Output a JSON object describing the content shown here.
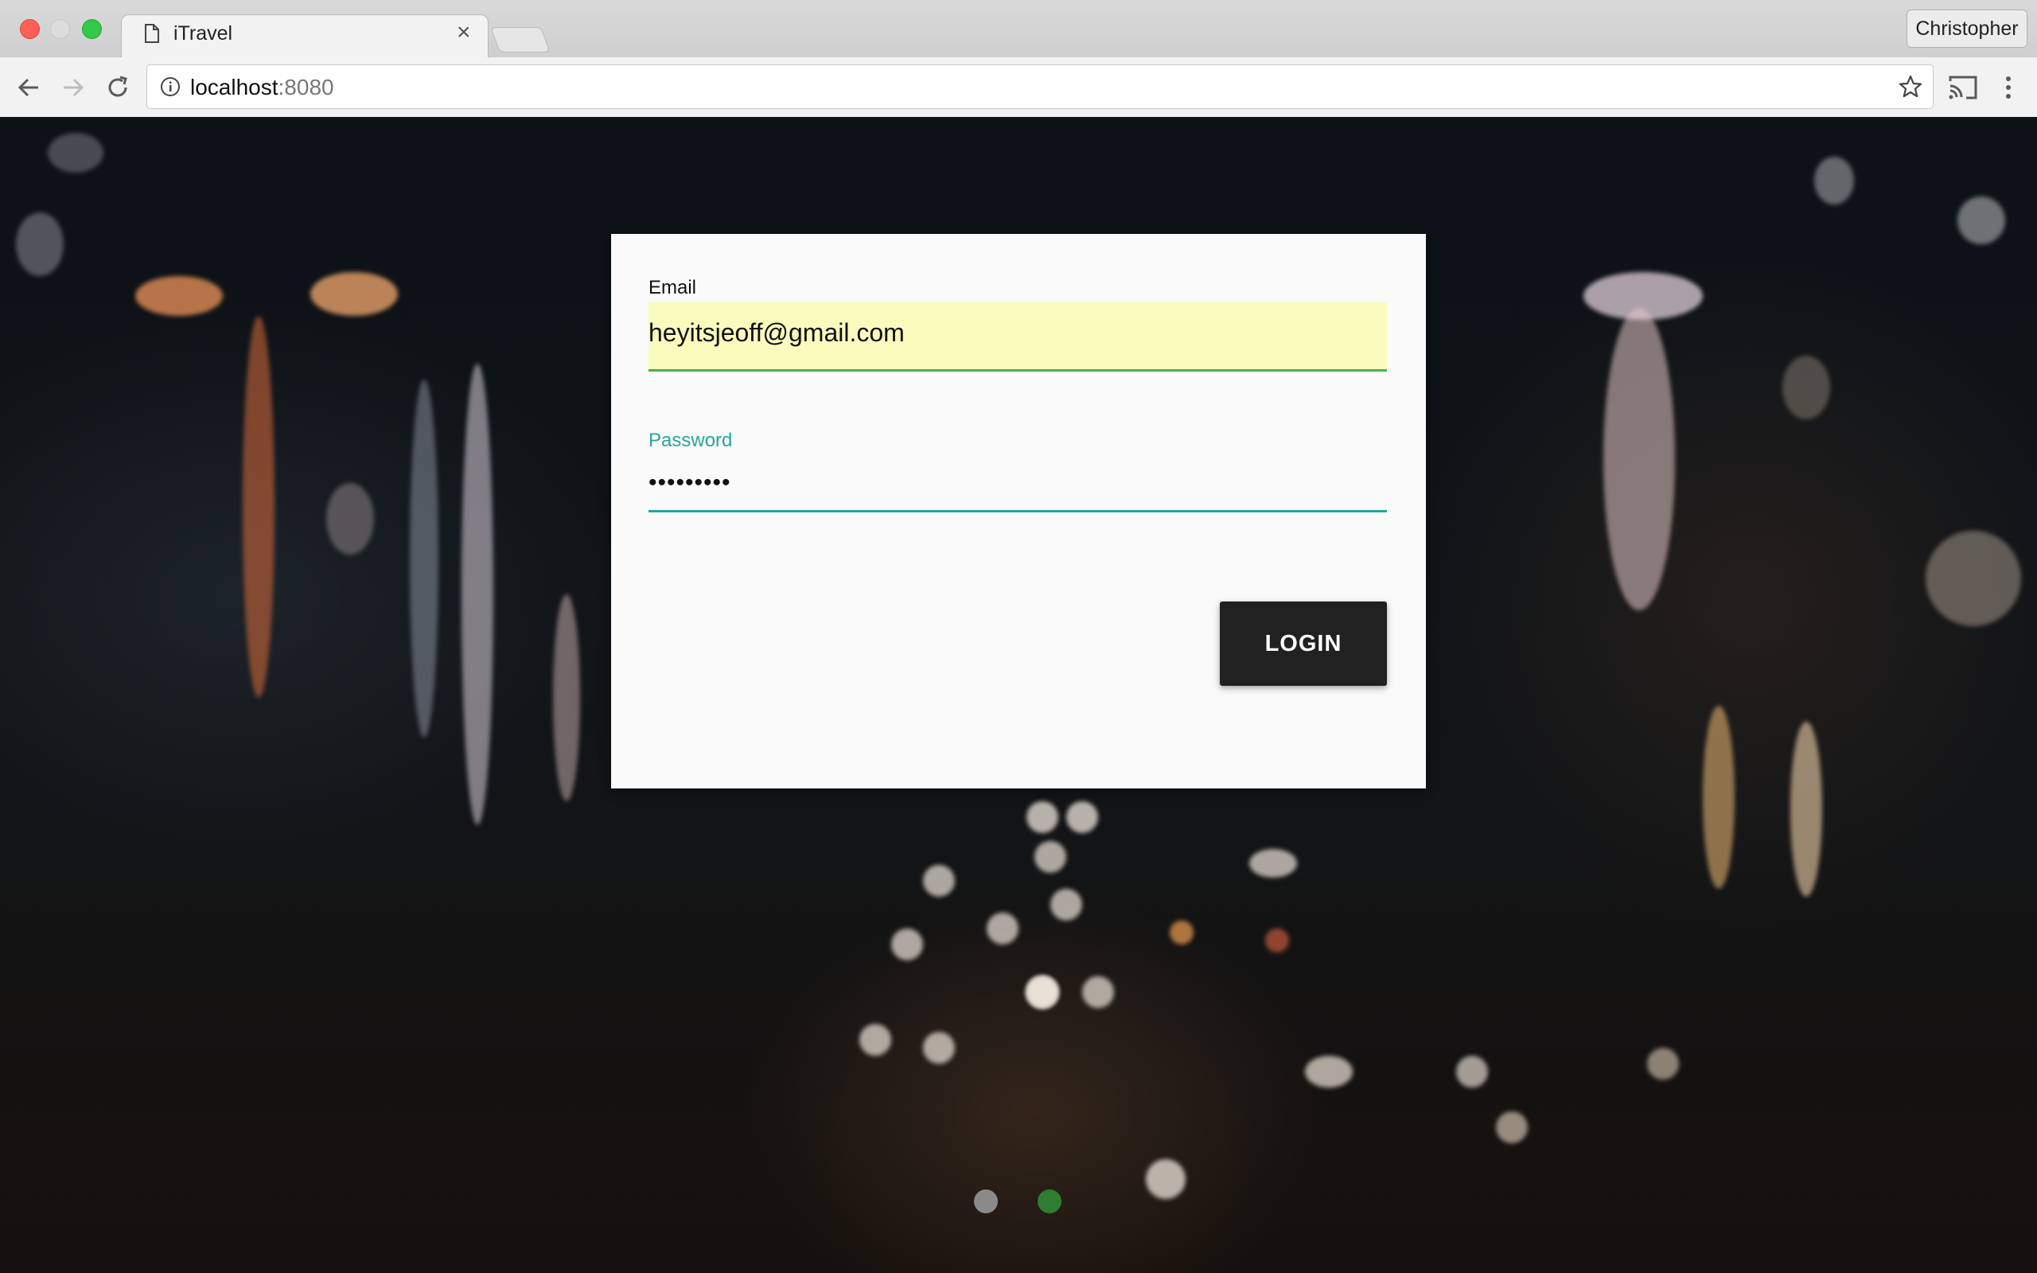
{
  "browser": {
    "tab_title": "iTravel",
    "tab_close": "×",
    "profile_name": "Christopher",
    "url_host": "localhost",
    "url_port": ":8080"
  },
  "login": {
    "email_label": "Email",
    "email_value": "heyitsjeoff@gmail.com",
    "password_label": "Password",
    "password_value": "•••••••••",
    "login_button": "LOGIN"
  },
  "colors": {
    "accent_teal": "#26a69a",
    "autofill_yellow": "#fafcbd",
    "email_underline": "#4caf50",
    "button_dark": "#212121"
  },
  "carousel": {
    "dots": [
      "inactive",
      "active"
    ]
  }
}
